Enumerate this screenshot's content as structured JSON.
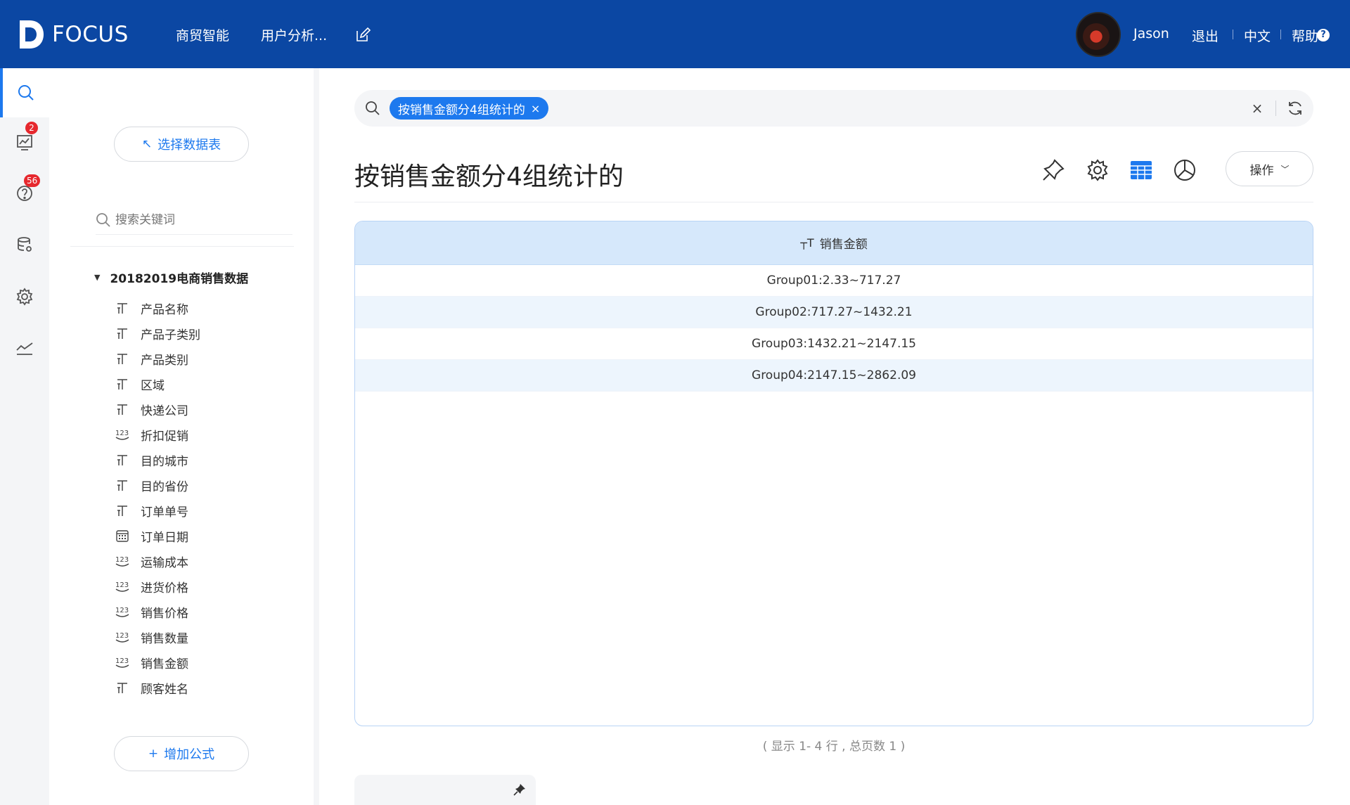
{
  "header": {
    "brand": "FOCUS",
    "nav": [
      "商贸智能",
      "用户分析..."
    ],
    "user_name": "Jason",
    "logout": "退出",
    "language": "中文",
    "help": "帮助",
    "help_icon_text": "?"
  },
  "rail": {
    "items": [
      "search-icon",
      "dashboard-icon",
      "question-icon",
      "database-icon",
      "settings-icon",
      "trend-icon"
    ],
    "badge_dashboard": "2",
    "badge_question": "56"
  },
  "data_panel": {
    "select_table_label": "选择数据表",
    "select_table_icon": "↖",
    "search_placeholder": "搜索关键词",
    "table_name": "20182019电商销售数据",
    "fields": [
      {
        "label": "产品名称",
        "type": "text"
      },
      {
        "label": "产品子类别",
        "type": "text"
      },
      {
        "label": "产品类别",
        "type": "text"
      },
      {
        "label": "区域",
        "type": "text"
      },
      {
        "label": "快递公司",
        "type": "text"
      },
      {
        "label": "折扣促销",
        "type": "number"
      },
      {
        "label": "目的城市",
        "type": "text"
      },
      {
        "label": "目的省份",
        "type": "text"
      },
      {
        "label": "订单单号",
        "type": "text"
      },
      {
        "label": "订单日期",
        "type": "date"
      },
      {
        "label": "运输成本",
        "type": "number"
      },
      {
        "label": "进货价格",
        "type": "number"
      },
      {
        "label": "销售价格",
        "type": "number"
      },
      {
        "label": "销售数量",
        "type": "number"
      },
      {
        "label": "销售金额",
        "type": "number"
      },
      {
        "label": "顾客姓名",
        "type": "text"
      }
    ],
    "add_formula_label": "增加公式",
    "add_formula_icon": "+"
  },
  "search": {
    "chip_text": "按销售金额分4组统计的",
    "chip_close": "×",
    "clear": "×"
  },
  "result": {
    "title": "按销售金额分4组统计的",
    "ops_label": "操作",
    "column_header": "销售金额",
    "column_header_icon": "┬T",
    "rows": [
      "Group01:2.33~717.27",
      "Group02:717.27~1432.21",
      "Group03:1432.21~2147.15",
      "Group04:2147.15~2862.09"
    ],
    "pager": "( 显示 1- 4 行 , 总页数 1 )"
  },
  "colors": {
    "header_bg": "#0b47a3",
    "accent": "#1d79ee",
    "badge": "#e6282e",
    "table_header": "#d6e8fb"
  }
}
